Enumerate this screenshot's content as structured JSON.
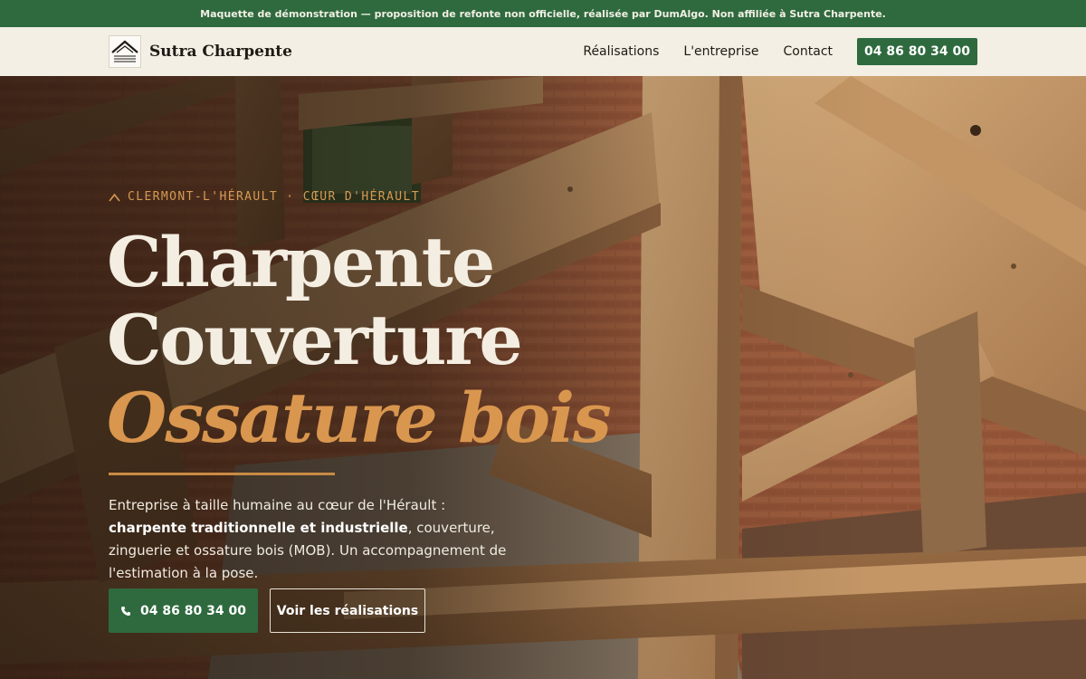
{
  "banner": {
    "text": "Maquette de démonstration — proposition de refonte non officielle, réalisée par DumAlgo. Non affiliée à Sutra Charpente."
  },
  "header": {
    "logo_text": "Sutra Charpente",
    "logo_icon": "house-roof-icon",
    "nav": [
      {
        "label": "Réalisations"
      },
      {
        "label": "L'entreprise"
      },
      {
        "label": "Contact"
      }
    ],
    "cta_phone": "04 86 80 34 00"
  },
  "hero": {
    "eyebrow": "CLERMONT-L'HÉRAULT · CŒUR D'HÉRAULT",
    "title_line_1": "Charpente",
    "title_line_2": "Couverture",
    "title_line_3": "Ossature bois",
    "lead_part_1": "Entreprise à taille humaine au cœur de l'Hérault : ",
    "lead_bold": "charpente traditionnelle et industrielle",
    "lead_part_2": ", couverture, zinguerie et ossature bois (MOB). Un accompagnement de l'estimation à la pose.",
    "primary_button": "04 86 80 34 00",
    "secondary_button": "Voir les réalisations",
    "background_image": "timber-roof-frame-photo"
  },
  "colors": {
    "brand_green": "#2e6a3e",
    "accent_ochre": "#d9964e",
    "header_bg": "#f3efe4",
    "title_text": "#f4eee2"
  }
}
